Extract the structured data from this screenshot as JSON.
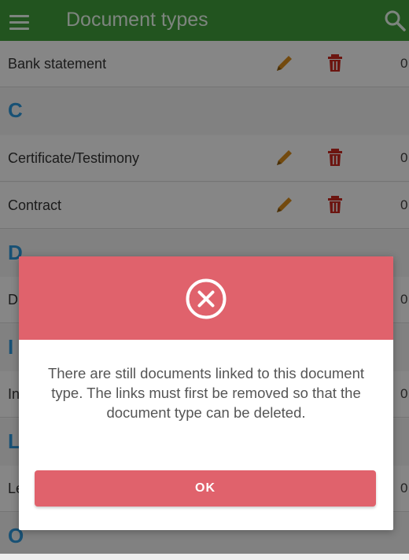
{
  "app_bar": {
    "title": "Document types"
  },
  "list": {
    "rows": [
      {
        "label": "Bank statement",
        "count": "0"
      },
      {
        "section": "C"
      },
      {
        "label": "Certificate/Testimony",
        "count": "0"
      },
      {
        "label": "Contract",
        "count": "0"
      },
      {
        "section": "D"
      },
      {
        "label": "D",
        "count": "0"
      },
      {
        "section": "I"
      },
      {
        "label": "In",
        "count": "0"
      },
      {
        "section": "L"
      },
      {
        "label": "Le",
        "count": "0"
      },
      {
        "section": "O"
      }
    ]
  },
  "dialog": {
    "message": "There are still documents linked to this document type. The links must first be removed so that the document type can be deleted.",
    "ok_label": "OK",
    "icon": "error-circle-x-icon",
    "accent_color": "#e0626c"
  },
  "colors": {
    "app_bar": "#3f9b3a",
    "section_letter": "#2d96d8",
    "edit_icon": "#d58a1a",
    "delete_icon": "#c8281e"
  }
}
